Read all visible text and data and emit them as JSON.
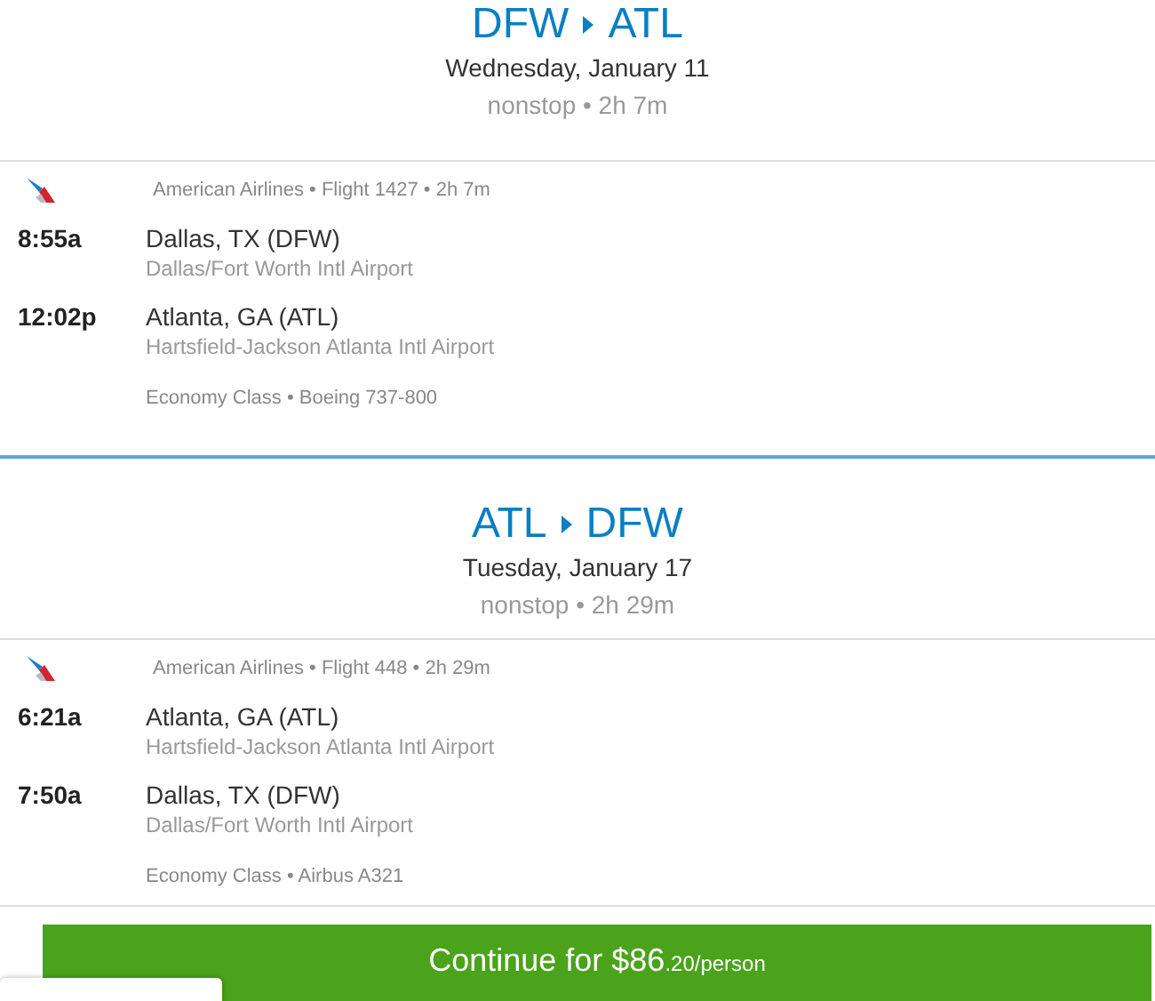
{
  "legs": [
    {
      "origin": "DFW",
      "destination": "ATL",
      "date": "Wednesday, January 11",
      "summary": "nonstop • 2h 7m",
      "segment": {
        "info": "American Airlines • Flight 1427 • 2h 7m",
        "stops": [
          {
            "time": "8:55a",
            "city": "Dallas, TX (DFW)",
            "airport": "Dallas/Fort Worth Intl Airport"
          },
          {
            "time": "12:02p",
            "city": "Atlanta, GA (ATL)",
            "airport": "Hartsfield-Jackson Atlanta Intl Airport"
          }
        ],
        "cabin": "Economy Class • Boeing 737-800"
      }
    },
    {
      "origin": "ATL",
      "destination": "DFW",
      "date": "Tuesday, January 17",
      "summary": "nonstop • 2h 29m",
      "segment": {
        "info": "American Airlines • Flight 448 • 2h 29m",
        "stops": [
          {
            "time": "6:21a",
            "city": "Atlanta, GA (ATL)",
            "airport": "Hartsfield-Jackson Atlanta Intl Airport"
          },
          {
            "time": "7:50a",
            "city": "Dallas, TX (DFW)",
            "airport": "Dallas/Fort Worth Intl Airport"
          }
        ],
        "cabin": "Economy Class • Airbus A321"
      }
    }
  ],
  "continue_button": {
    "label": "Continue for $86",
    "cents": ".20/person"
  }
}
